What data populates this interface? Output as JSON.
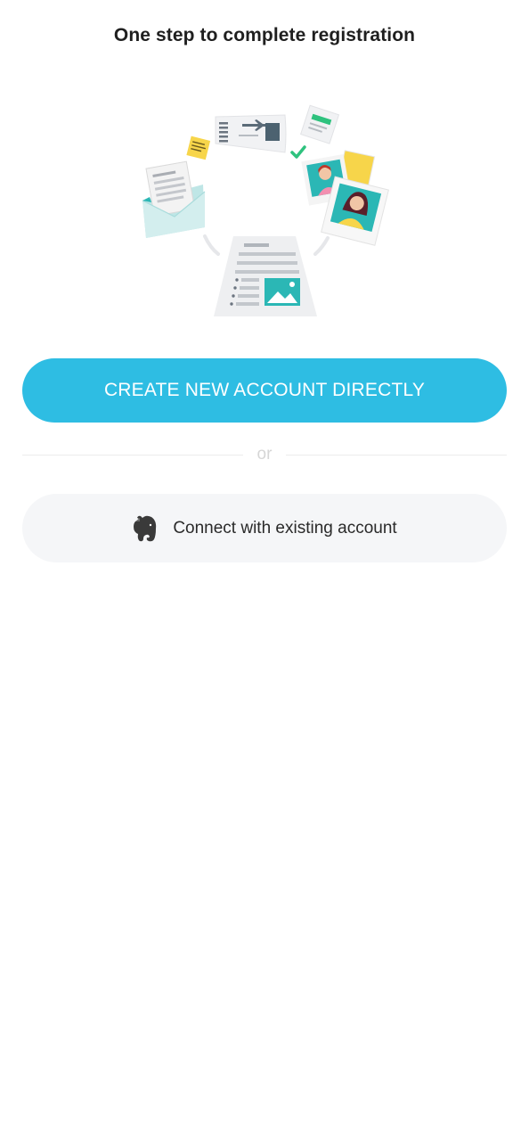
{
  "header": {
    "title": "One step to complete registration"
  },
  "illustration": {
    "icon": "registration-documents-illustration"
  },
  "actions": {
    "primary_label": "CREATE NEW ACCOUNT DIRECTLY",
    "divider_label": "or",
    "secondary_label": "Connect with existing account",
    "secondary_icon": "evernote-elephant-icon"
  },
  "colors": {
    "primary": "#2ebde3",
    "secondary_bg": "#f5f6f8",
    "teal_accent": "#2bb7b5",
    "check_green": "#2ec27e",
    "note_yellow": "#f7d54a"
  }
}
